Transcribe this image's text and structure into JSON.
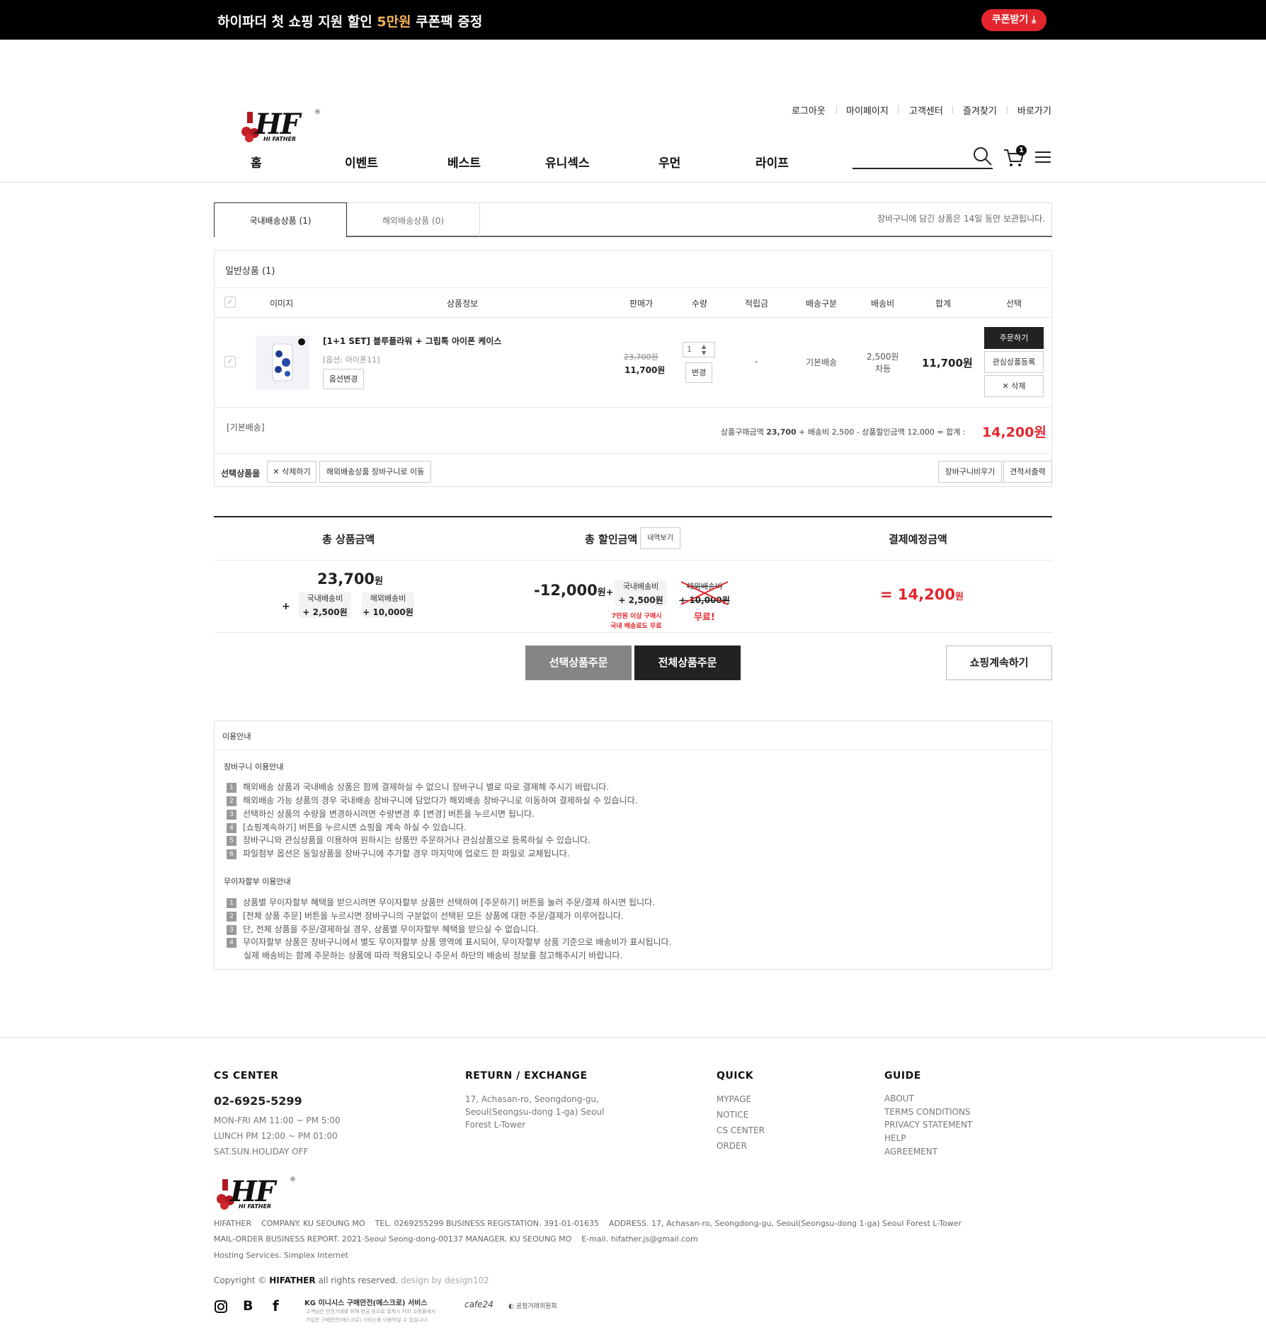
{
  "banner": {
    "text_a": "하이파더 첫 쇼핑 지원 할인 ",
    "text_hl": "5만원",
    "text_b": " 쿠폰팩 증정",
    "coupon_btn": "쿠폰받기"
  },
  "header": {
    "logo": "HF",
    "logo_sub": "HI FATHER",
    "util": [
      "로그아웃",
      "마이페이지",
      "고객센터",
      "즐겨찾기",
      "바로가기"
    ],
    "nav": [
      "홈",
      "이벤트",
      "베스트",
      "유니섹스",
      "우먼",
      "라이프"
    ],
    "cart_count": "1"
  },
  "tabs": {
    "domestic": "국내배송상품 (1)",
    "overseas": "해외배송상품 (0)",
    "note": "장바구니에 담긴 상품은 14일 동안 보관됩니다."
  },
  "cart": {
    "section_title": "일반상품 (1)",
    "columns": [
      "이미지",
      "상품정보",
      "판매가",
      "수량",
      "적립금",
      "배송구분",
      "배송비",
      "합계",
      "선택"
    ],
    "item": {
      "name": "[1+1 SET] 블루플라워 + 그립톡 아이폰 케이스",
      "option": "[옵션: 아이폰11]",
      "option_btn": "옵션변경",
      "price_old": "23,700원",
      "price": "11,700원",
      "qty": "1",
      "qty_btn": "변경",
      "mileage": "-",
      "ship_type": "기본배송",
      "ship_fee": "2,500원",
      "ship_fee_note": "차등",
      "total": "11,700원",
      "actions": [
        "주문하기",
        "관심상품등록",
        "✕ 삭제"
      ]
    },
    "basic_ship": "[기본배송]",
    "summary_a": "상품구매금액 ",
    "summary_b": "23,700",
    "summary_c": " + 배송비 2,500 - 상품할인금액 12,000 = 합계 : ",
    "summary_total": "14,200원",
    "sel_label": "선택상품을",
    "sel_delete": "✕ 삭제하기",
    "sel_move": "해외배송상품 장바구니로 이동",
    "btn_clear": "장바구니비우기",
    "btn_estimate": "견적서출력"
  },
  "totals": {
    "h_product": "총 상품금액",
    "h_discount": "총 할인금액",
    "h_detail": "내역보기",
    "h_pay": "결제예정금액",
    "product_amount": "23,700",
    "won": "원",
    "plus": "+",
    "dom_ship_label": "국내배송비",
    "dom_ship": "+ 2,500원",
    "ovs_ship_label": "해외배송비",
    "ovs_ship": "+ 10,000원",
    "discount_amount": "-12,000",
    "discount_won": "원+",
    "d_dom_label": "국내배송비",
    "d_dom": "+ 2,500원",
    "d_ovs_label": "해외배송비",
    "d_ovs": "+ 10,000원",
    "free_note_1": "7만원 이상 구매시",
    "free_note_2": "국내 배송료도 무료",
    "free": "무료!",
    "pay": "= 14,200",
    "pay_won": "원"
  },
  "buttons": {
    "order_selected": "선택상품주문",
    "order_all": "전체상품주문",
    "continue": "쇼핑계속하기"
  },
  "guide": {
    "title": "이용안내",
    "cart_title": "장바구니 이용안내",
    "cart_items": [
      "해외배송 상품과 국내배송 상품은 함께 결제하실 수 없으니 장바구니 별로 따로 결제해 주시기 바랍니다.",
      "해외배송 가능 상품의 경우 국내배송 장바구니에 담았다가 해외배송 장바구니로 이동하여 결제하실 수 있습니다.",
      "선택하신 상품의 수량을 변경하시려면 수량변경 후 [변경] 버튼을 누르시면 됩니다.",
      "[쇼핑계속하기] 버튼을 누르시면 쇼핑을 계속 하실 수 있습니다.",
      "장바구니와 관심상품을 이용하여 원하시는 상품만 주문하거나 관심상품으로 등록하실 수 있습니다.",
      "파일첨부 옵션은 동일상품을 장바구니에 추가할 경우 마지막에 업로드 한 파일로 교체됩니다."
    ],
    "install_title": "무이자할부 이용안내",
    "install_items": [
      "상품별 무이자할부 혜택을 받으시려면 무이자할부 상품만 선택하여 [주문하기] 버튼을 눌러 주문/결제 하시면 됩니다.",
      "[전체 상품 주문] 버튼을 누르시면 장바구니의 구분없이 선택된 모든 상품에 대한 주문/결제가 이루어집니다.",
      "단, 전체 상품을 주문/결제하실 경우, 상품별 무이자할부 혜택을 받으실 수 없습니다.",
      "무이자할부 상품은 장바구니에서 별도 무이자할부 상품 영역에 표시되어, 무이자할부 상품 기준으로 배송비가 표시됩니다."
    ],
    "install_extra": "실제 배송비는 함께 주문하는 상품에 따라 적용되오니 주문서 하단의 배송비 정보를 참고해주시기 바랍니다."
  },
  "footer": {
    "cs_title": "CS CENTER",
    "cs_phone": "02-6925-5299",
    "cs_hours": [
      "MON-FRI AM 11:00 ~ PM 5:00",
      "LUNCH PM 12:00 ~ PM 01:00",
      "SAT.SUN.HOLIDAY OFF"
    ],
    "ret_title": "RETURN / EXCHANGE",
    "ret_addr": [
      "17, Achasan-ro, Seongdong-gu,",
      "Seoul(Seongsu-dong 1-ga) Seoul",
      "Forest L-Tower"
    ],
    "quick_title": "QUICK",
    "quick": [
      "MYPAGE",
      "NOTICE",
      "CS CENTER",
      "ORDER"
    ],
    "guide_title": "GUIDE",
    "guide": [
      "ABOUT",
      "TERMS CONDITIONS",
      "PRIVACY STATEMENT",
      "HELP",
      "AGREEMENT"
    ],
    "info1": "HIFATHER    COMPANY. KU SEOUNG MO    TEL. 0269255299 BUSINESS REGISTATION. 391-01-01635    ADDRESS. 17, Achasan-ro, Seongdong-gu, Seoul(Seongsu-dong 1-ga) Seoul Forest L-Tower",
    "info2": "MAIL-ORDER BUSINESS REPORT. 2021-Seoul Seong-dong-00137 MANAGER. KU SEOUNG MO    E-mail. hifather.js@gmail.com",
    "info3": "Hosting Services. Simplex Internet",
    "copy_a": "Copyright © ",
    "copy_b": "HIFATHER",
    "copy_c": " all rights reserved. ",
    "copy_d": "design by design102",
    "kg": "KG 이니시스 구매안전(에스크로) 서비스",
    "kg_sub1": "고객님은 안전거래를 위해 현금 등으로 결제시 저희 쇼핑몰에서",
    "kg_sub2": "가입한 구매안전(에스크로) 서비스를 이용하실 수 있습니다.",
    "cafe24": "cafe24",
    "ftc": "공정거래위원회"
  },
  "colors": {
    "accent": "#e3262d",
    "highlight": "#f5b35a",
    "dark": "#222222"
  }
}
